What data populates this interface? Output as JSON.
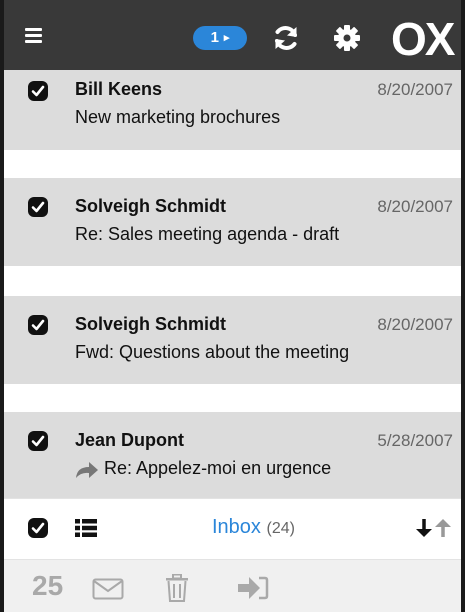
{
  "header": {
    "badge_count": "1",
    "badge_arrow": "▸",
    "logo": "OX",
    "icons": [
      "menu-icon",
      "refresh-icon",
      "gear-icon"
    ]
  },
  "messages": [
    {
      "sender": "Bill Keens",
      "date": "8/20/2007",
      "subject": "New marketing brochures",
      "selected": true,
      "replied": false
    },
    {
      "sender": "Solveigh Schmidt",
      "date": "8/20/2007",
      "subject": "Re: Sales meeting agenda - draft",
      "selected": true,
      "replied": false
    },
    {
      "sender": "Solveigh Schmidt",
      "date": "8/20/2007",
      "subject": "Fwd: Questions about the meeting",
      "selected": true,
      "replied": false
    },
    {
      "sender": "Jean Dupont",
      "date": "5/28/2007",
      "subject": "Re: Appelez-moi en urgence",
      "selected": true,
      "replied": true
    }
  ],
  "toolbar": {
    "folder_name": "Inbox",
    "folder_count": "(24)"
  },
  "actions": {
    "selected_count": "25"
  },
  "colors": {
    "accent": "#2b86d9",
    "header_bg": "#393939",
    "selected_row_bg": "#dcdcdc"
  }
}
